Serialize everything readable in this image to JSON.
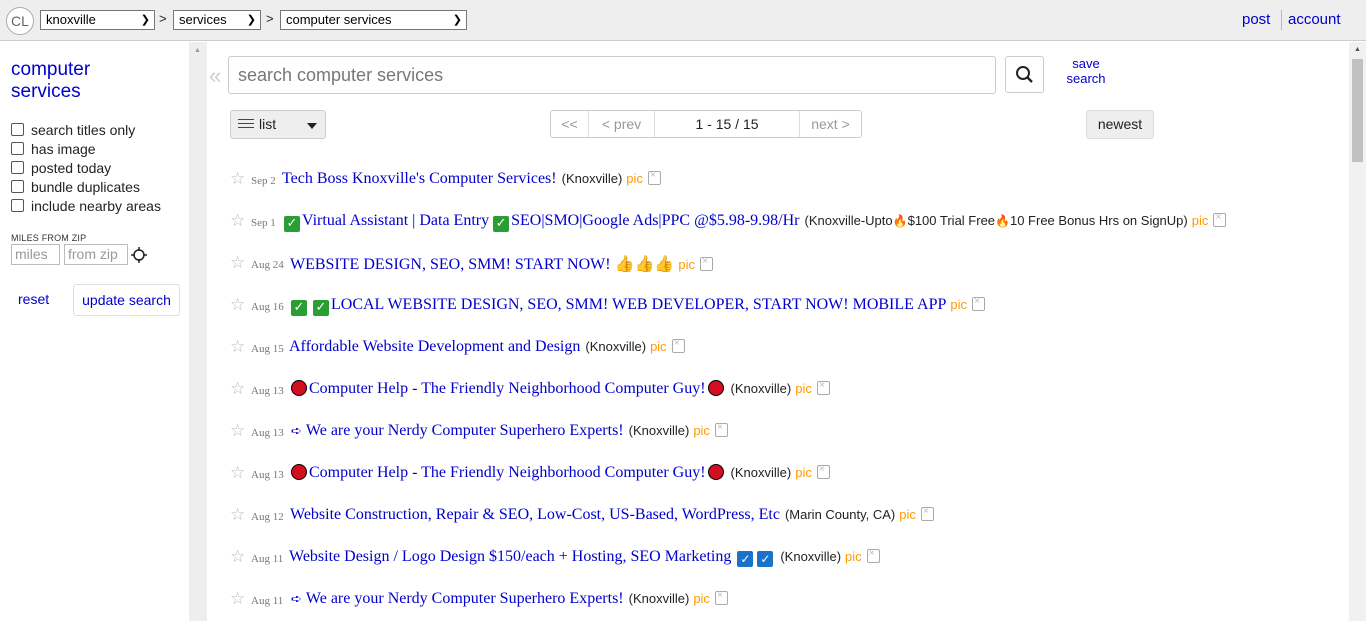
{
  "header": {
    "logo": "CL",
    "location": "knoxville",
    "category": "services",
    "subcategory": "computer services",
    "sep": ">",
    "post": "post",
    "account": "account"
  },
  "sidebar": {
    "title_line1": "computer",
    "title_line2": "services",
    "filters": [
      "search titles only",
      "has image",
      "posted today",
      "bundle duplicates",
      "include nearby areas"
    ],
    "miles_label": "MILES FROM ZIP",
    "miles_placeholder": "miles",
    "zip_placeholder": "from zip",
    "reset": "reset",
    "update": "update search"
  },
  "search": {
    "collapse": "«",
    "placeholder": "search computer services",
    "save_line1": "save",
    "save_line2": "search"
  },
  "toolbar": {
    "view": "list",
    "first": "<<",
    "prev": "< prev",
    "range": "1 - 15 / 15",
    "next": "next >",
    "sort": "newest"
  },
  "listings": [
    {
      "date": "Sep 2",
      "title": "Tech Boss Knoxville's Computer Services!",
      "hood": "(Knoxville)",
      "pic": "pic"
    },
    {
      "date": "Sep 1",
      "title_a": "Virtual Assistant | Data Entry",
      "title_b": "SEO|SMO|Google Ads|PPC @$5.98-9.98/Hr",
      "hood_a": "(Knoxville-Upto",
      "hood_b": "$100 Trial Free",
      "hood_c": "10 Free Bonus Hrs on SignUp)",
      "pic": "pic"
    },
    {
      "date": "Aug 24",
      "title": "WEBSITE DESIGN, SEO, SMM! START NOW!",
      "pic": "pic"
    },
    {
      "date": "Aug 16",
      "title": "LOCAL WEBSITE DESIGN, SEO, SMM! WEB DEVELOPER, START NOW! MOBILE APP",
      "pic": "pic"
    },
    {
      "date": "Aug 15",
      "title": "Affordable Website Development and Design",
      "hood": "(Knoxville)",
      "pic": "pic"
    },
    {
      "date": "Aug 13",
      "title": "Computer Help - The Friendly Neighborhood Computer Guy!",
      "hood": "(Knoxville)",
      "pic": "pic"
    },
    {
      "date": "Aug 13",
      "title": "We are your Nerdy Computer Superhero Experts!",
      "hood": "(Knoxville)",
      "pic": "pic"
    },
    {
      "date": "Aug 13",
      "title": "Computer Help - The Friendly Neighborhood Computer Guy!",
      "hood": "(Knoxville)",
      "pic": "pic"
    },
    {
      "date": "Aug 12",
      "title": "Website Construction, Repair & SEO, Low-Cost, US-Based, WordPress, Etc",
      "hood": "(Marin County, CA)",
      "pic": "pic"
    },
    {
      "date": "Aug 11",
      "title": "Website Design / Logo Design $150/each + Hosting, SEO Marketing",
      "hood": "(Knoxville)",
      "pic": "pic"
    },
    {
      "date": "Aug 11",
      "title": "We are your Nerdy Computer Superhero Experts!",
      "hood": "(Knoxville)",
      "pic": "pic"
    }
  ],
  "icons": {
    "star": "☆",
    "search": "magnifier",
    "check": "✓",
    "arrow": "➪",
    "thumb": "👍",
    "fire": "🔥"
  },
  "colors": {
    "link": "#0000cc",
    "pic": "#ff9900",
    "topbar": "#eeeeee"
  }
}
